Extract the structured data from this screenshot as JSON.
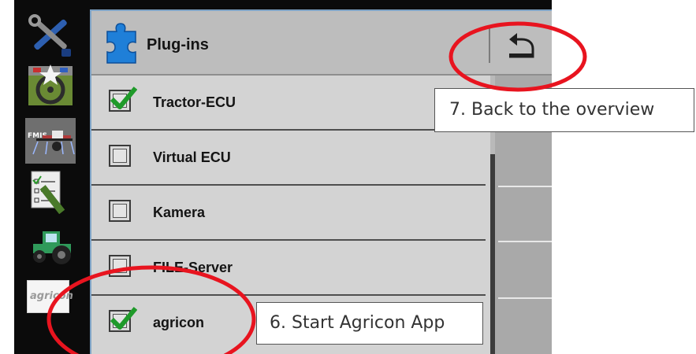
{
  "panel": {
    "title": "Plug-ins"
  },
  "sidebar": {
    "fmis_label": "FMIS",
    "agricon_label": "agricon"
  },
  "plugins": [
    {
      "label": "Tractor-ECU",
      "checked": true
    },
    {
      "label": "Virtual ECU",
      "checked": false
    },
    {
      "label": "Kamera",
      "checked": false
    },
    {
      "label": "FILE-Server",
      "checked": false
    },
    {
      "label": "agricon",
      "checked": true
    }
  ],
  "annotations": {
    "back": "7. Back to the overview",
    "start": "6. Start Agricon App"
  },
  "colors": {
    "highlight_ring": "#e8141f",
    "check_green": "#1f9a2a",
    "panel_border": "#7fa3c5"
  }
}
